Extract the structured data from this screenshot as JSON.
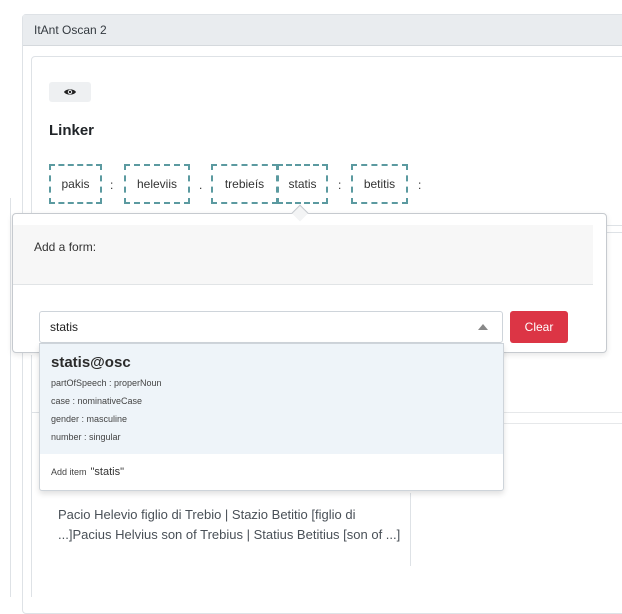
{
  "panel": {
    "title": "ItAnt Oscan 2"
  },
  "linker": {
    "heading": "Linker",
    "tokens": [
      "pakis",
      "heleviis",
      "trebieís",
      "statis",
      "betitis"
    ],
    "separators": [
      ":",
      ":",
      ".",
      ":",
      ":"
    ]
  },
  "popover": {
    "header_label": "Add a form:",
    "select_value": "statis",
    "clear_label": "Clear",
    "option": {
      "title": "statis@osc",
      "properties": [
        "partOfSpeech : properNoun",
        "case : nominativeCase",
        "gender : masculine",
        "number : singular"
      ]
    },
    "add_item_prefix": "Add item",
    "add_item_value": "\"statis\""
  },
  "translation": {
    "text": "Pacio Helevio figlio di Trebio | Stazio Betitio [figlio di ...]Pacius Helvius son of Trebius | Statius Betitius [son of ...]"
  },
  "icons": {
    "toggle": "eye-icon",
    "dropdown": "caret-up-icon"
  },
  "colors": {
    "token_border": "#5b9aa0",
    "clear_button": "#dc3545",
    "selected_option_bg": "#eef4f9"
  }
}
